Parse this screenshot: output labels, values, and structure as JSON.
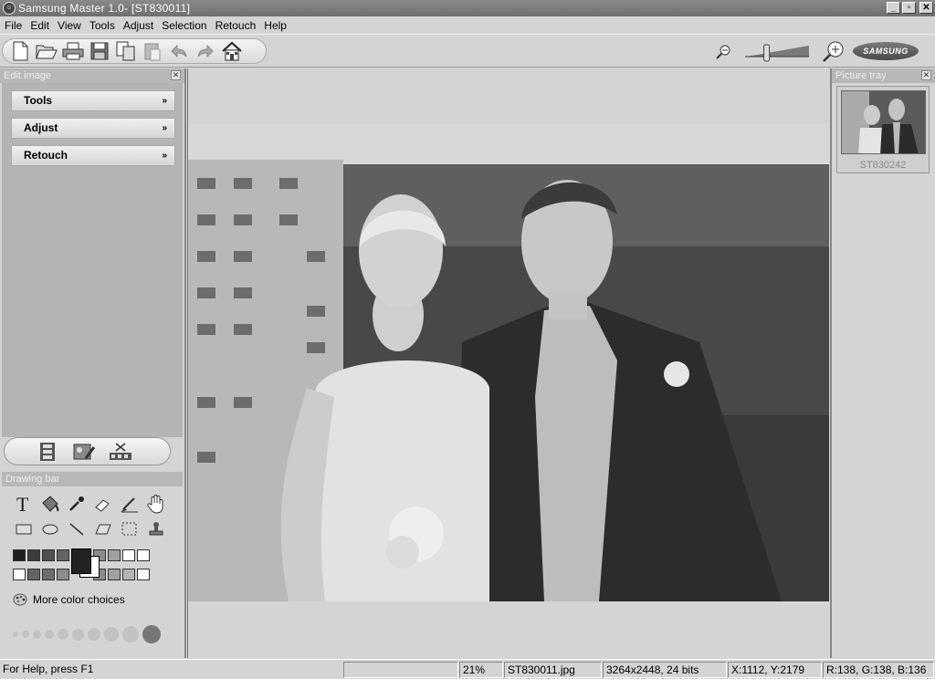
{
  "window": {
    "title": "Samsung Master 1.0- [ST830011]",
    "buttons": [
      "_",
      "▫",
      "✕"
    ]
  },
  "menu": [
    "File",
    "Edit",
    "View",
    "Tools",
    "Adjust",
    "Selection",
    "Retouch",
    "Help"
  ],
  "toolbar": {
    "buttons": [
      "new-file-icon",
      "open-folder-icon",
      "print-icon",
      "save-icon",
      "copy-icon",
      "paste-icon",
      "undo-icon",
      "redo-icon",
      "home-icon"
    ],
    "zoom_out_icon": "zoom-out-icon",
    "zoom_in_icon": "zoom-in-icon",
    "zoom_level": 0.3,
    "logo": "SAMSUNG"
  },
  "edit_panel": {
    "title": "Edit image",
    "sections": [
      "Tools",
      "Adjust",
      "Retouch"
    ],
    "view_buttons": [
      "film-strip-icon",
      "image-edit-icon",
      "movie-edit-icon"
    ]
  },
  "drawing_bar": {
    "title": "Drawing bar",
    "tools_row1": [
      "text-tool-icon",
      "fill-bucket-icon",
      "eyedropper-icon",
      "eraser-icon",
      "brush-icon",
      "hand-icon"
    ],
    "tools_row2": [
      "rectangle-icon",
      "ellipse-icon",
      "line-icon",
      "parallelogram-icon",
      "selection-icon",
      "stamp-icon"
    ],
    "swatches_row1": [
      "#1e1e1e",
      "#3c3c3c",
      "#505050",
      "#646464",
      "#787878",
      "#8c8c8c",
      "#a0a0a0",
      "#ffffff",
      "#ffffff"
    ],
    "swatches_row2": [
      "#ffffff",
      "#646464",
      "#6e6e6e",
      "#8c8c8c",
      "#787878",
      "#8c8c8c",
      "#a0a0a0",
      "#b4b4b4",
      "#ffffff"
    ],
    "foreground_color": "#222222",
    "background_color": "#ffffff",
    "more_colors": "More color choices",
    "brush_sizes": [
      6,
      8,
      9,
      10,
      12,
      13,
      14,
      16,
      18,
      20
    ]
  },
  "picture_tray": {
    "title": "Picture tray",
    "items": [
      {
        "label": "ST830242"
      }
    ]
  },
  "status": {
    "help": "For Help, press F1",
    "empty": "",
    "zoom": "21%",
    "filename": "ST830011.jpg",
    "dimensions": "3264x2448, 24 bits",
    "coords": "X:1112, Y:2179",
    "rgb": "R:138, G:138, B:136"
  }
}
